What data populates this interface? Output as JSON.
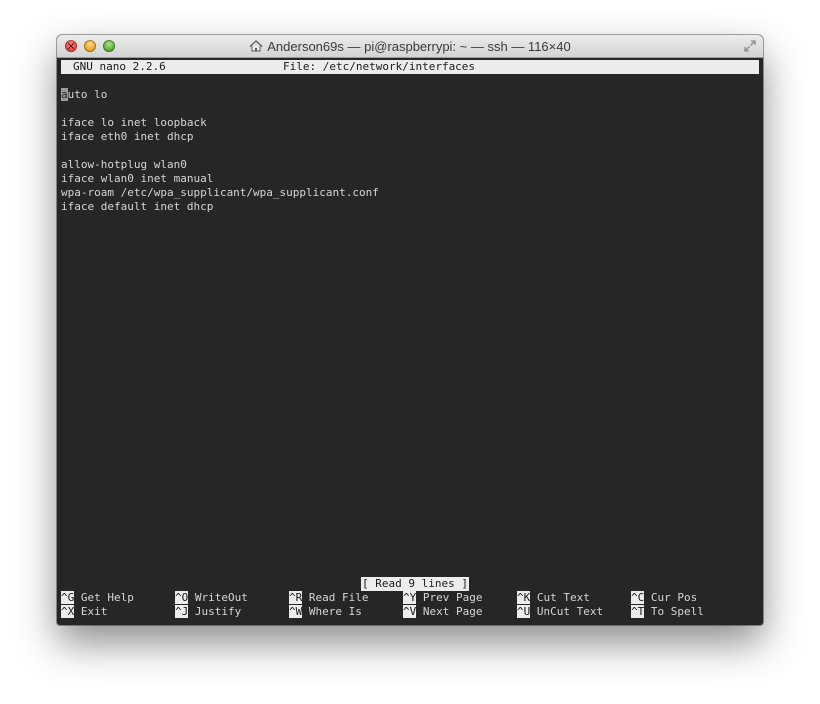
{
  "window": {
    "title": "Anderson69s — pi@raspberrypi: ~ — ssh — 116×40"
  },
  "nano": {
    "version": "GNU nano 2.2.6",
    "file_label": "File: /etc/network/interfaces",
    "cursor_char": "a",
    "lines": [
      "",
      "uto lo",
      "",
      "iface lo inet loopback",
      "iface eth0 inet dhcp",
      "",
      "allow-hotplug wlan0",
      "iface wlan0 inet manual",
      "wpa-roam /etc/wpa_supplicant/wpa_supplicant.conf",
      "iface default inet dhcp"
    ],
    "status": "[ Read 9 lines ]",
    "shortcuts": [
      {
        "key": "^G",
        "label": "Get Help"
      },
      {
        "key": "^O",
        "label": "WriteOut"
      },
      {
        "key": "^R",
        "label": "Read File"
      },
      {
        "key": "^Y",
        "label": "Prev Page"
      },
      {
        "key": "^K",
        "label": "Cut Text"
      },
      {
        "key": "^C",
        "label": "Cur Pos"
      },
      {
        "key": "^X",
        "label": "Exit"
      },
      {
        "key": "^J",
        "label": "Justify"
      },
      {
        "key": "^W",
        "label": "Where Is"
      },
      {
        "key": "^V",
        "label": "Next Page"
      },
      {
        "key": "^U",
        "label": "UnCut Text"
      },
      {
        "key": "^T",
        "label": "To Spell"
      }
    ]
  },
  "icons": {
    "title_icon": "home-icon",
    "resize_icon": "fullscreen-icon"
  }
}
